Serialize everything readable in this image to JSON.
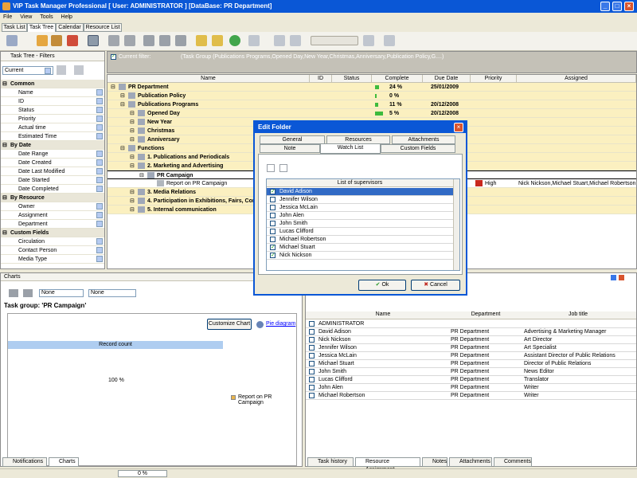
{
  "window": {
    "title": "VIP Task Manager Professional [ User: ADMINISTRATOR ] [DataBase: PR Department]"
  },
  "menu": [
    "File",
    "View",
    "Tools",
    "Help"
  ],
  "main_tabs": [
    "Task List",
    "Task Tree",
    "Calendar",
    "Resource List"
  ],
  "filters_panel": {
    "title": "Task Tree - Filters",
    "view_select": "Current",
    "sections": [
      {
        "label": "Common",
        "items": [
          "Name",
          "ID",
          "Status",
          "Priority",
          "Actual time",
          "Estimated Time"
        ]
      },
      {
        "label": "By Date",
        "items": [
          "Date Range",
          "Date Created",
          "Date Last Modified",
          "Date Started",
          "Date Completed"
        ]
      },
      {
        "label": "By Resource",
        "items": [
          "Owner",
          "Assignment",
          "Department"
        ]
      },
      {
        "label": "Custom Fields",
        "items": [
          "Circulation",
          "Contact Person",
          "Media Type"
        ]
      }
    ]
  },
  "current_filter": {
    "label": "Current filter:",
    "value": "(Task Group  (Publications Programs,Opened Day,New Year,Christmas,Anniversary,Publication Policy,G....)"
  },
  "grid": {
    "columns": [
      "Name",
      "ID",
      "Status",
      "Complete",
      "Due Date",
      "Priority",
      "Assigned"
    ],
    "rows": [
      {
        "name": "PR Department",
        "complete": "24 %",
        "pct": 24,
        "due": "25/01/2009",
        "priority": "",
        "assigned": "",
        "style": "root",
        "indent": 0
      },
      {
        "name": "Publication Policy",
        "complete": "0 %",
        "pct": 0,
        "due": "",
        "priority": "",
        "assigned": "",
        "style": "group",
        "indent": 1
      },
      {
        "name": "Publications Programs",
        "complete": "11 %",
        "pct": 11,
        "due": "20/12/2008",
        "priority": "",
        "assigned": "",
        "style": "group",
        "indent": 1
      },
      {
        "name": "Opened Day",
        "complete": "5 %",
        "pct": 60,
        "due": "20/12/2008",
        "priority": "",
        "assigned": "",
        "style": "group",
        "indent": 2
      },
      {
        "name": "New Year",
        "complete": "",
        "pct": 0,
        "due": "",
        "priority": "",
        "assigned": "",
        "style": "group",
        "indent": 2
      },
      {
        "name": "Christmas",
        "complete": "",
        "pct": 0,
        "due": "",
        "priority": "",
        "assigned": "",
        "style": "group",
        "indent": 2
      },
      {
        "name": "Anniversary",
        "complete": "",
        "pct": 0,
        "due": "",
        "priority": "",
        "assigned": "",
        "style": "group",
        "indent": 2
      },
      {
        "name": "Functions",
        "complete": "",
        "pct": 0,
        "due": "",
        "priority": "",
        "assigned": "",
        "style": "group",
        "indent": 1
      },
      {
        "name": "1. Publications and Periodicals",
        "complete": "",
        "pct": 0,
        "due": "",
        "priority": "",
        "assigned": "",
        "style": "group",
        "indent": 2
      },
      {
        "name": "2. Marketing and Advertising",
        "complete": "",
        "pct": 0,
        "due": "",
        "priority": "",
        "assigned": "",
        "style": "group",
        "indent": 2
      },
      {
        "name": "PR Campaign",
        "complete": "",
        "pct": 0,
        "due": "",
        "priority": "",
        "assigned": "",
        "style": "group",
        "indent": 3
      },
      {
        "name": "Report on PR Campaign",
        "complete": "",
        "pct": 0,
        "due": "",
        "priority": "High",
        "assigned": "Nick Nickson,Michael Stuart,Michael Robertson",
        "style": "task",
        "indent": 4
      },
      {
        "name": "3. Media Relations",
        "complete": "",
        "pct": 0,
        "due": "",
        "priority": "",
        "assigned": "",
        "style": "group",
        "indent": 2
      },
      {
        "name": "4. Participation in Exhibitions, Fairs, Con",
        "complete": "",
        "pct": 0,
        "due": "",
        "priority": "",
        "assigned": "",
        "style": "group",
        "indent": 2
      },
      {
        "name": "5. Internal communication",
        "complete": "",
        "pct": 0,
        "due": "",
        "priority": "",
        "assigned": "",
        "style": "group",
        "indent": 2
      }
    ]
  },
  "charts_panel": {
    "title": "Charts",
    "select1": "None",
    "select2": "None",
    "group_label": "Task group: 'PR Campaign'",
    "customize_btn": "Customize Chart",
    "diagram_link": "Pie diagram",
    "bar_label": "Record count",
    "percent_label": "100 %",
    "legend_label": "Report on PR Campaign",
    "legend_color": "#e9b44c",
    "bottom_tabs": [
      "Notifications",
      "Charts"
    ]
  },
  "resource_table": {
    "columns": [
      "Name",
      "Department",
      "Job title"
    ],
    "rows": [
      {
        "name": "ADMINISTRATOR",
        "dept": "",
        "job": ""
      },
      {
        "name": "David Adison",
        "dept": "PR Department",
        "job": "Advertising & Marketing Manager"
      },
      {
        "name": "Nick Nickson",
        "dept": "PR Department",
        "job": "Art Director"
      },
      {
        "name": "Jennifer Wilson",
        "dept": "PR Department",
        "job": "Art Specialist"
      },
      {
        "name": "Jessica McLain",
        "dept": "PR Department",
        "job": "Assistant Director of Public Relations"
      },
      {
        "name": "Michael Stuart",
        "dept": "PR Department",
        "job": "Director of Public Relations"
      },
      {
        "name": "John Smith",
        "dept": "PR Department",
        "job": "News Editor"
      },
      {
        "name": "Lucas Clifford",
        "dept": "PR Department",
        "job": "Translator"
      },
      {
        "name": "John Alen",
        "dept": "PR Department",
        "job": "Writer"
      },
      {
        "name": "Michael Robertson",
        "dept": "PR Department",
        "job": "Writer"
      }
    ],
    "bottom_tabs": [
      "Task history",
      "Resource Assignment",
      "Notes",
      "Attachments",
      "Comments"
    ]
  },
  "status_bar": {
    "progress_text": "0 %"
  },
  "dialog": {
    "title": "Edit Folder",
    "tabs_row1": [
      "General",
      "Resources",
      "Attachments"
    ],
    "tabs_row2": [
      "Note",
      "Watch List",
      "Custom Fields"
    ],
    "list_header": "List of supervisors",
    "supervisors": [
      {
        "name": "David Adison",
        "checked": true,
        "selected": true
      },
      {
        "name": "Jennifer Wilson",
        "checked": false,
        "selected": false
      },
      {
        "name": "Jessica McLain",
        "checked": false,
        "selected": false
      },
      {
        "name": "John Alen",
        "checked": false,
        "selected": false
      },
      {
        "name": "John Smith",
        "checked": false,
        "selected": false
      },
      {
        "name": "Lucas Clifford",
        "checked": false,
        "selected": false
      },
      {
        "name": "Michael Robertson",
        "checked": false,
        "selected": false
      },
      {
        "name": "Michael Stuart",
        "checked": true,
        "selected": false
      },
      {
        "name": "Nick Nickson",
        "checked": true,
        "selected": false
      }
    ],
    "ok": "Ok",
    "cancel": "Cancel"
  }
}
